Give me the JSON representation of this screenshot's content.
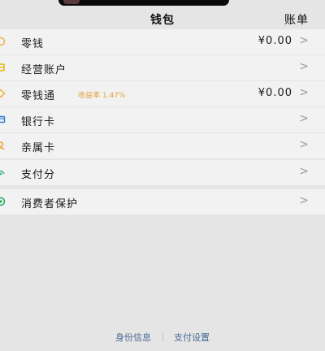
{
  "header": {
    "title": "钱包",
    "right_label": "账单"
  },
  "groups": [
    {
      "items": [
        {
          "label": "零钱",
          "value": "¥0.00",
          "icon": "coin-icon",
          "icon_color": "#f0b33a"
        },
        {
          "label": "经营账户",
          "value": "",
          "icon": "store-icon",
          "icon_color": "#e8b400"
        },
        {
          "label": "零钱通",
          "sub": "收益率 1.47%",
          "value": "¥0.00",
          "icon": "diamond-icon",
          "icon_color": "#f0b33a"
        },
        {
          "label": "银行卡",
          "value": "",
          "icon": "card-icon",
          "icon_color": "#2d7fd3"
        },
        {
          "label": "亲属卡",
          "value": "",
          "icon": "family-card-icon",
          "icon_color": "#e9a42f"
        }
      ]
    },
    {
      "items": [
        {
          "label": "支付分",
          "value": "",
          "icon": "score-icon",
          "icon_color": "#35b67a"
        }
      ]
    },
    {
      "items": [
        {
          "label": "消费者保护",
          "value": "",
          "icon": "shield-icon",
          "icon_color": "#1aad5a"
        }
      ]
    }
  ],
  "arrow": ">",
  "footer": {
    "left": "身份信息",
    "right": "支付设置"
  },
  "colors": {
    "background": "#e5e5e5",
    "row_background": "#f2f2f2",
    "footer_link": "#4a6a94",
    "accent_orange": "#e4a23a"
  }
}
